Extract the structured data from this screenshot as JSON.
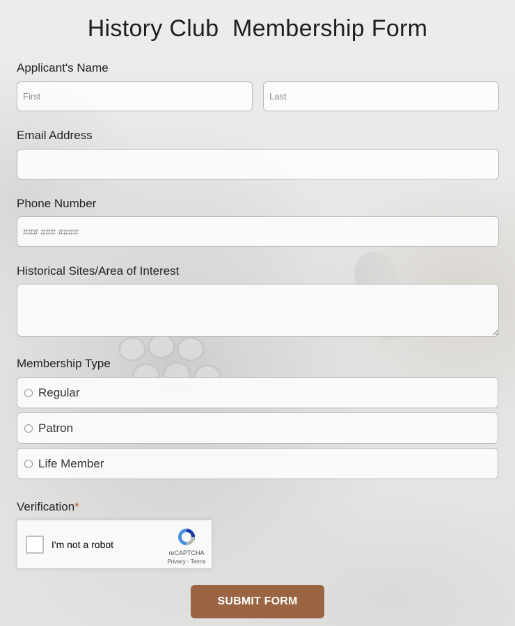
{
  "form": {
    "title": "History Club  Membership Form",
    "name": {
      "label": "Applicant's Name",
      "first_placeholder": "First",
      "last_placeholder": "Last",
      "first_value": "",
      "last_value": ""
    },
    "email": {
      "label": "Email Address",
      "value": ""
    },
    "phone": {
      "label": "Phone Number",
      "placeholder": "### ### ####",
      "value": ""
    },
    "interest": {
      "label": "Historical Sites/Area of Interest",
      "value": ""
    },
    "membership": {
      "label": "Membership Type",
      "options": [
        {
          "label": "Regular",
          "selected": false
        },
        {
          "label": "Patron",
          "selected": false
        },
        {
          "label": "Life Member",
          "selected": false
        }
      ]
    },
    "verification": {
      "label": "Verification",
      "required_mark": "*",
      "captcha_text": "I'm not a robot",
      "captcha_brand": "reCAPTCHA",
      "captcha_terms": "Privacy - Terms"
    },
    "submit_label": "SUBMIT FORM"
  },
  "colors": {
    "accent": "#9b6543",
    "required": "#b85a2a",
    "field_border": "#b9b9b9"
  },
  "icons": {
    "captcha_logo": "recaptcha-icon",
    "radio": "radio-circle-icon",
    "checkbox": "checkbox-icon"
  }
}
